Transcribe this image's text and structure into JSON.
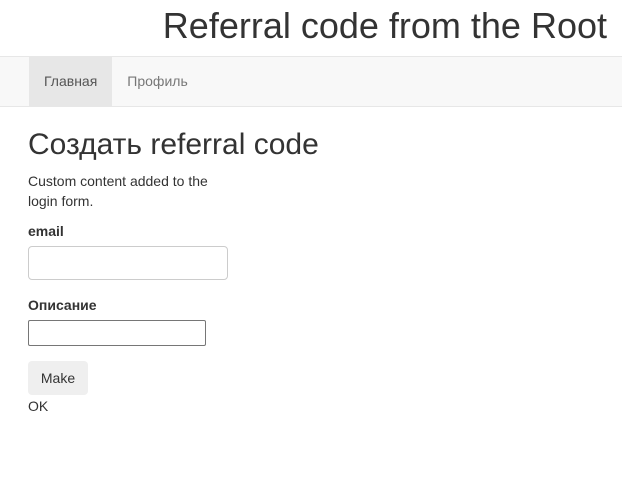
{
  "header": {
    "title": "Referral code from the Root"
  },
  "nav": {
    "items": [
      {
        "label": "Главная",
        "active": true
      },
      {
        "label": "Профиль",
        "active": false
      }
    ]
  },
  "main": {
    "page_title": "Создать referral code",
    "custom_content": "Custom content added to the login form.",
    "form": {
      "email_label": "email",
      "email_value": "",
      "description_label": "Описание",
      "description_value": "",
      "submit_label": "Make"
    },
    "status": "OK"
  }
}
